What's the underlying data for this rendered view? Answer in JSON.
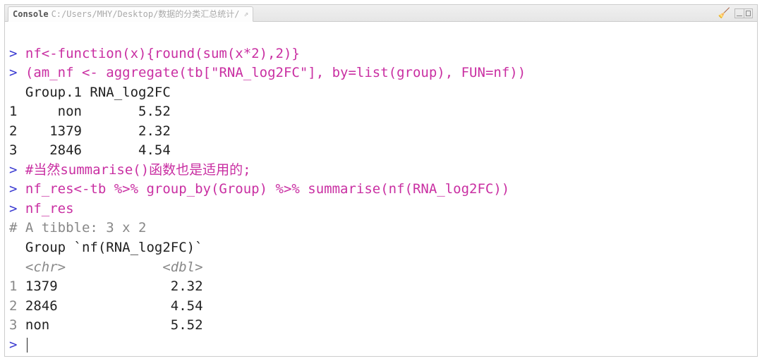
{
  "tab": {
    "label": "Console",
    "path": "C:/Users/MHY/Desktop/数据的分类汇总统计/"
  },
  "lines": {
    "l1_cmd": "nf<-function(x){round(sum(x*2),2)}",
    "l2_a": "(am_nf <- aggregate(tb[",
    "l2_str": "\"RNA_log2FC\"",
    "l2_b": "], by=list(group), FUN=nf))",
    "l3": "  Group.1 RNA_log2FC",
    "l4": "1     non       5.52",
    "l5": "2    1379       2.32",
    "l6": "3    2846       4.54",
    "l7_cmd": "#当然summarise()函数也是适用的;",
    "l8_cmd": "nf_res<-tb %>% group_by(Group) %>% summarise(nf(RNA_log2FC))",
    "l9_cmd": "nf_res",
    "l10_a": "# A tibble: 3 x 2",
    "l11": "  Group `nf(RNA_log2FC)`",
    "l12a": "  <chr>",
    "l12b": "            <dbl>",
    "l13": "1 1379              2.32",
    "l14": "2 2846              4.54",
    "l15": "3 non               5.52"
  },
  "chart_data": {
    "type": "table",
    "tables": [
      {
        "title": "aggregate result",
        "columns": [
          "Group.1",
          "RNA_log2FC"
        ],
        "rows": [
          [
            "non",
            5.52
          ],
          [
            "1379",
            2.32
          ],
          [
            "2846",
            4.54
          ]
        ]
      },
      {
        "title": "tibble 3 x 2",
        "columns": [
          "Group",
          "nf(RNA_log2FC)"
        ],
        "coltypes": [
          "<chr>",
          "<dbl>"
        ],
        "rows": [
          [
            "1379",
            2.32
          ],
          [
            "2846",
            4.54
          ],
          [
            "non",
            5.52
          ]
        ]
      }
    ]
  }
}
